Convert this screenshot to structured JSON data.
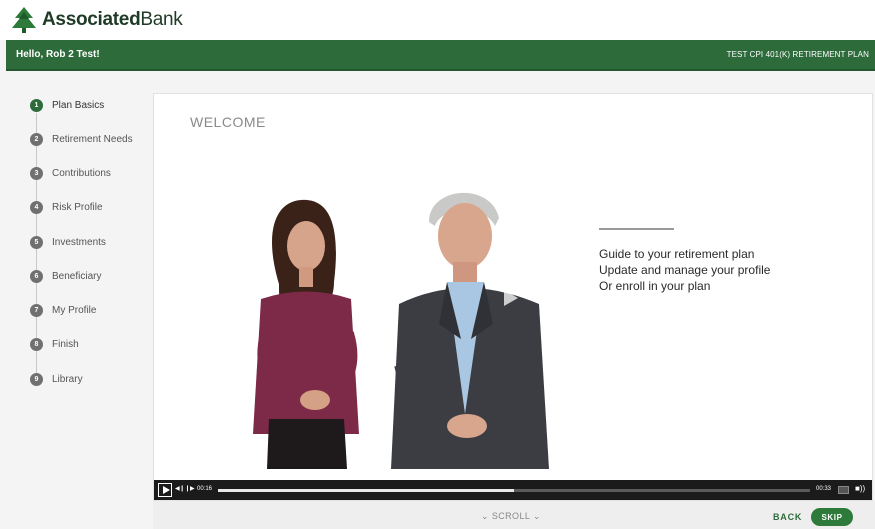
{
  "brand": {
    "name_bold": "Associated",
    "name_regular": "Bank",
    "logo_icon": "associated-bank-tree-logo",
    "colors": {
      "primary_green": "#2d6b3a",
      "button_green": "#2d7a3a"
    }
  },
  "header": {
    "greeting": "Hello, Rob 2 Test!",
    "plan_name": "TEST CPI 401(K) RETIREMENT PLAN"
  },
  "sidebar": {
    "steps": [
      {
        "number": "1",
        "label": "Plan Basics",
        "active": true
      },
      {
        "number": "2",
        "label": "Retirement Needs",
        "active": false
      },
      {
        "number": "3",
        "label": "Contributions",
        "active": false
      },
      {
        "number": "4",
        "label": "Risk Profile",
        "active": false
      },
      {
        "number": "5",
        "label": "Investments",
        "active": false
      },
      {
        "number": "6",
        "label": "Beneficiary",
        "active": false
      },
      {
        "number": "7",
        "label": "My Profile",
        "active": false
      },
      {
        "number": "8",
        "label": "Finish",
        "active": false
      },
      {
        "number": "9",
        "label": "Library",
        "active": false
      }
    ]
  },
  "video": {
    "title": "WELCOME",
    "lines": [
      "Guide to your retirement plan",
      "Update and manage your profile",
      "Or enroll in your plan"
    ],
    "controls": {
      "current_time": "00:16",
      "duration": "00:33",
      "progress": 0.5,
      "icons": [
        "play-icon",
        "rewind-icon",
        "forward-icon",
        "captions-icon",
        "volume-icon"
      ]
    }
  },
  "footer": {
    "scroll_label": "SCROLL",
    "back_label": "BACK",
    "skip_label": "SKIP"
  }
}
